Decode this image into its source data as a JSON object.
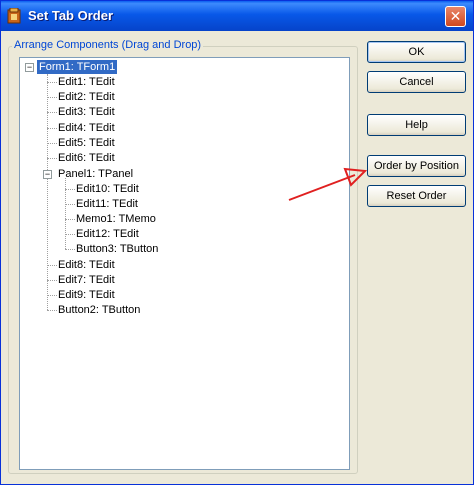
{
  "window": {
    "title": "Set Tab Order",
    "close_glyph": "✕"
  },
  "group": {
    "label": "Arrange Components (Drag and Drop)"
  },
  "tree": {
    "expander_glyph": "−",
    "nodes": [
      {
        "label": "Form1: TForm1",
        "selected": true
      },
      {
        "label": "Edit1: TEdit"
      },
      {
        "label": "Edit2: TEdit"
      },
      {
        "label": "Edit3: TEdit"
      },
      {
        "label": "Edit4: TEdit"
      },
      {
        "label": "Edit5: TEdit"
      },
      {
        "label": "Edit6: TEdit"
      },
      {
        "label": "Panel1: TPanel"
      },
      {
        "label": "Edit10: TEdit"
      },
      {
        "label": "Edit11: TEdit"
      },
      {
        "label": "Memo1: TMemo"
      },
      {
        "label": "Edit12: TEdit"
      },
      {
        "label": "Button3: TButton"
      },
      {
        "label": "Edit8: TEdit"
      },
      {
        "label": "Edit7: TEdit"
      },
      {
        "label": "Edit9: TEdit"
      },
      {
        "label": "Button2: TButton"
      }
    ]
  },
  "buttons": {
    "ok": "OK",
    "cancel": "Cancel",
    "help": "Help",
    "order_by_position": "Order by Position",
    "reset_order": "Reset Order"
  },
  "colors": {
    "selection": "#316ac5",
    "annotation_arrow": "#e02020",
    "titlebar": "#0858e8"
  }
}
